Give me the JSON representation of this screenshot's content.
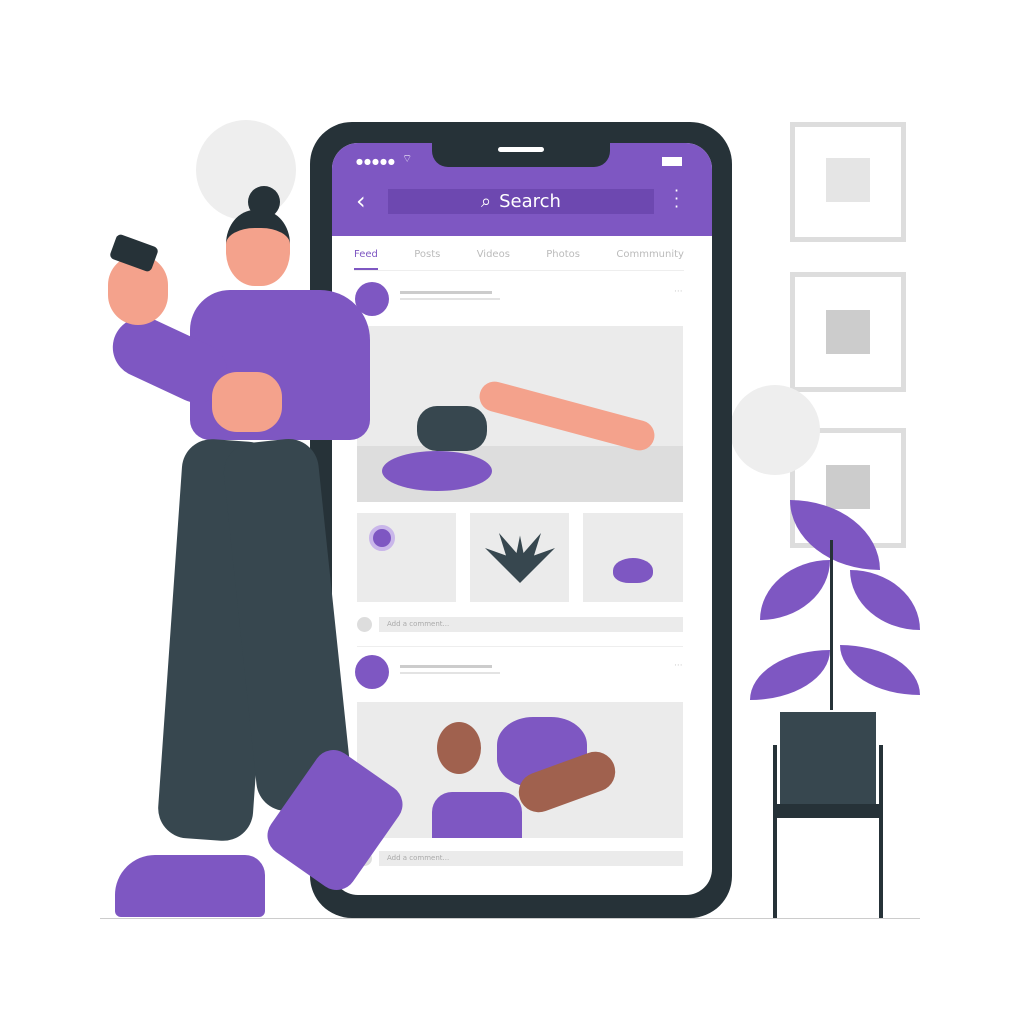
{
  "phone": {
    "search_label": "Search",
    "tabs": [
      "Feed",
      "Posts",
      "Videos",
      "Photos",
      "Commmunity"
    ],
    "active_tab": "Feed",
    "comment_placeholder": "Add a comment...",
    "icons": [
      "signal-dots-icon",
      "wifi-icon",
      "battery-icon",
      "back-chevron-icon",
      "search-icon",
      "more-vertical-icon"
    ]
  },
  "colors": {
    "accent": "#7e57c2",
    "dark": "#263238",
    "skin": "#f4a28c"
  }
}
